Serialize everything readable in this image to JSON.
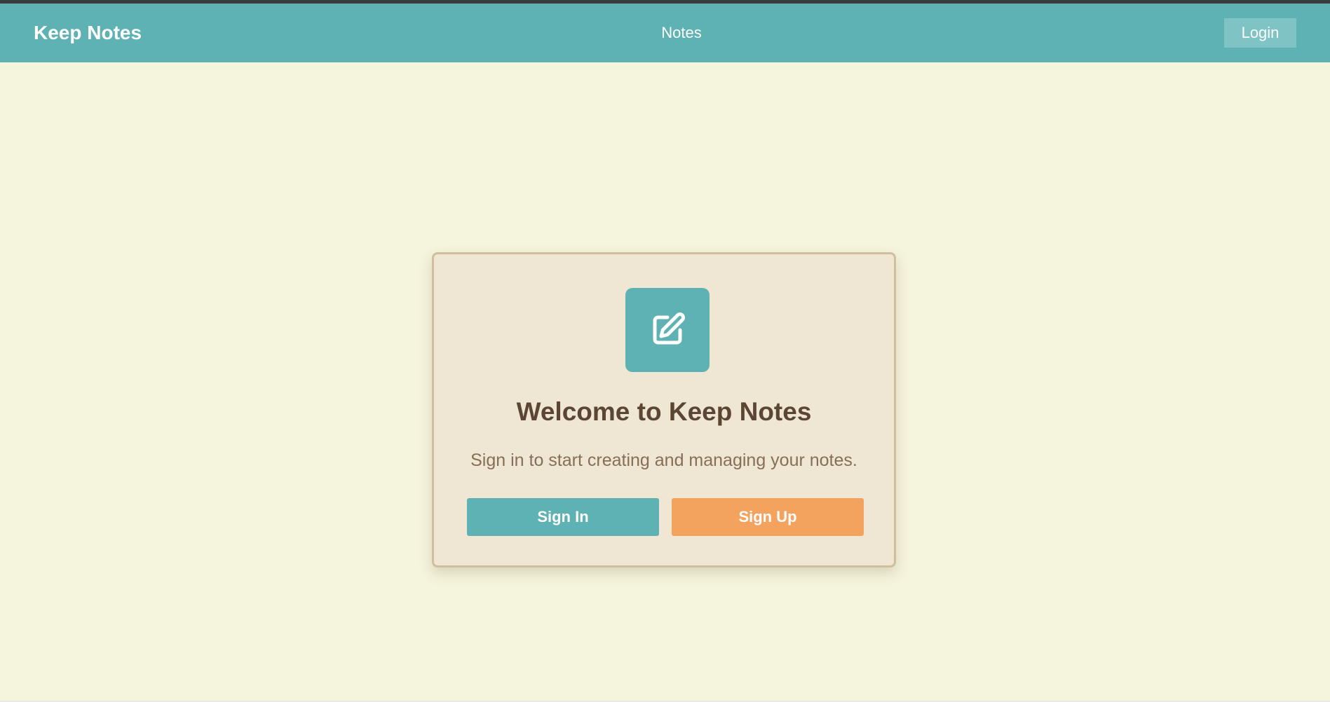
{
  "navbar": {
    "brand": "Keep Notes",
    "center_link": "Notes",
    "login_label": "Login"
  },
  "welcome": {
    "icon": "edit-note-icon",
    "title": "Welcome to Keep Notes",
    "subtitle": "Sign in to start creating and managing your notes.",
    "signin_label": "Sign In",
    "signup_label": "Sign Up"
  },
  "colors": {
    "background": "#f5f4dc",
    "navbar": "#5fb2b3",
    "card": "#f0e6d4",
    "card_border": "#cfbf9f",
    "primary": "#5fb2b3",
    "accent": "#f4a35f",
    "title_text": "#5b4634",
    "subtitle_text": "#866f57"
  }
}
